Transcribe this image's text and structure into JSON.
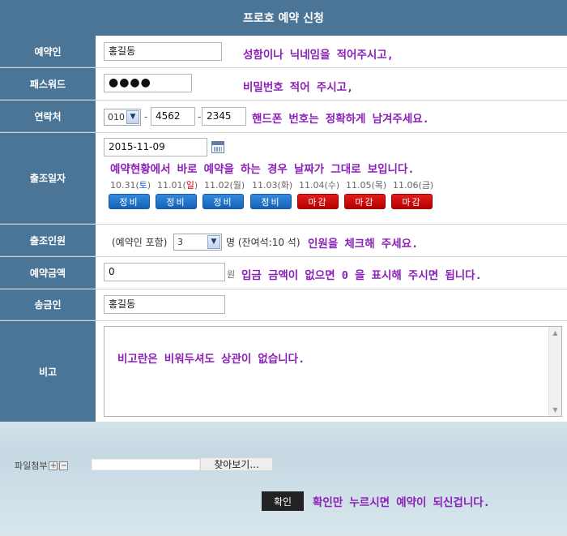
{
  "page_title": "프로호 예약 신청",
  "rows": {
    "name": {
      "label": "예약인",
      "value": "홍길동",
      "hint": "성함이나 닉네임을 적어주시고,"
    },
    "password": {
      "label": "패스워드",
      "value": "●●●●",
      "hint": "비밀번호 적어 주시고,"
    },
    "contact": {
      "label": "연락처",
      "prefix": "010",
      "middle": "4562",
      "last": "2345",
      "separator": "-",
      "hint": "핸드폰 번호는 정확하게 남겨주세요."
    },
    "date": {
      "label": "출조일자",
      "value": "2015-11-09",
      "hint": "예약현황에서 바로 예약을 하는 경우 날짜가 그대로 보입니다.",
      "days": [
        {
          "date": "10.31(",
          "dow": "토",
          "close": ")",
          "dow_color": "blue",
          "status": "정비",
          "status_color": "blue"
        },
        {
          "date": "11.01(",
          "dow": "일",
          "close": ")",
          "dow_color": "red",
          "status": "정비",
          "status_color": "blue"
        },
        {
          "date": "11.02(",
          "dow": "월",
          "close": ")",
          "dow_color": "none",
          "status": "정비",
          "status_color": "blue"
        },
        {
          "date": "11.03(",
          "dow": "화",
          "close": ")",
          "dow_color": "none",
          "status": "정비",
          "status_color": "blue"
        },
        {
          "date": "11.04(",
          "dow": "수",
          "close": ")",
          "dow_color": "none",
          "status": "마감",
          "status_color": "red"
        },
        {
          "date": "11.05(",
          "dow": "목",
          "close": ")",
          "dow_color": "none",
          "status": "마감",
          "status_color": "red"
        },
        {
          "date": "11.06(",
          "dow": "금",
          "close": ")",
          "dow_color": "none",
          "status": "마감",
          "status_color": "red"
        }
      ]
    },
    "people": {
      "label": "출조인원",
      "prefix": "(예약인 포함)",
      "value": "3",
      "suffix": "명 (잔여석:10 석)",
      "hint": "인원을 체크해 주세요."
    },
    "amount": {
      "label": "예약금액",
      "value": "0",
      "unit": "원",
      "hint": "입금 금액이 없으면 0 을 표시해 주시면 됩니다."
    },
    "sender": {
      "label": "송금인",
      "value": "홍길동"
    },
    "memo": {
      "label": "비고",
      "value": "비고란은 비워두셔도 상관이 없습니다."
    }
  },
  "file": {
    "label": "파일첨부",
    "plus": "+",
    "minus": "−",
    "browse_label": "찾아보기..."
  },
  "confirm": {
    "label": "확인",
    "hint": "확인만 누르시면 예약이 되신겁니다."
  },
  "colors": {
    "label_bg": "#4a7596",
    "hint": "#8b21b8",
    "slot_blue": "#1a6ec8",
    "slot_red": "#cc0000"
  }
}
